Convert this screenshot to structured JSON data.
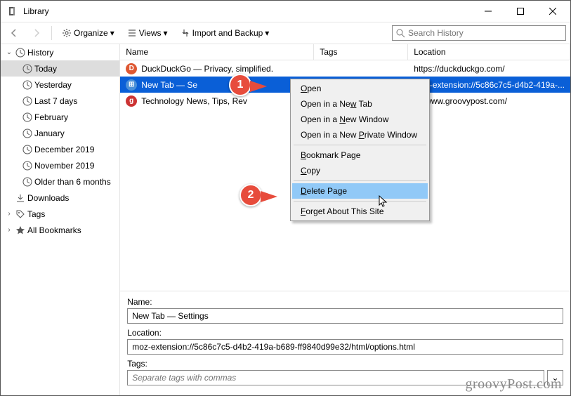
{
  "window": {
    "title": "Library"
  },
  "toolbar": {
    "organize": "Organize",
    "views": "Views",
    "import": "Import and Backup",
    "search_placeholder": "Search History"
  },
  "sidebar": {
    "history": "History",
    "items": [
      "Today",
      "Yesterday",
      "Last 7 days",
      "February",
      "January",
      "December 2019",
      "November 2019",
      "Older than 6 months"
    ],
    "downloads": "Downloads",
    "tags": "Tags",
    "bookmarks": "All Bookmarks"
  },
  "columns": {
    "name": "Name",
    "tags": "Tags",
    "location": "Location"
  },
  "rows": [
    {
      "title": "DuckDuckGo — Privacy, simplified.",
      "location": "https://duckduckgo.com/"
    },
    {
      "title": "New Tab — Se",
      "location": "moz-extension://5c86c7c5-d4b2-419a-..."
    },
    {
      "title": "Technology News, Tips, Rev",
      "location": "s://www.groovypost.com/"
    }
  ],
  "context_menu": {
    "open": "Open",
    "new_tab": "Open in a New Tab",
    "new_window": "Open in a New Window",
    "private_window": "Open in a New Private Window",
    "bookmark": "Bookmark Page",
    "copy": "Copy",
    "delete": "Delete Page",
    "forget": "Forget About This Site"
  },
  "callouts": {
    "one": "1",
    "two": "2"
  },
  "details": {
    "name_label": "Name:",
    "name_value": "New Tab — Settings",
    "location_label": "Location:",
    "location_value": "moz-extension://5c86c7c5-d4b2-419a-b689-ff9840d99e32/html/options.html",
    "tags_label": "Tags:",
    "tags_placeholder": "Separate tags with commas"
  },
  "watermark": "groovyPost.com"
}
